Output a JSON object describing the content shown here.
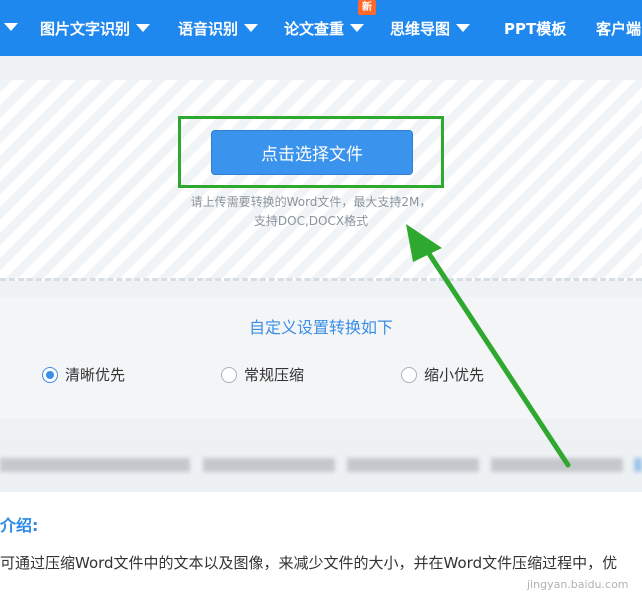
{
  "nav": {
    "items": [
      {
        "label": "图片文字识别",
        "dropdown": true
      },
      {
        "label": "语音识别",
        "dropdown": true
      },
      {
        "label": "论文查重",
        "dropdown": true,
        "badge": "新"
      },
      {
        "label": "思维导图",
        "dropdown": true
      },
      {
        "label": "PPT模板",
        "dropdown": false
      },
      {
        "label": "客户端",
        "dropdown": false
      }
    ]
  },
  "upload": {
    "button_label": "点击选择文件",
    "hint_line1": "请上传需要转换的Word文件，最大支持2M，",
    "hint_line2": "支持DOC,DOCX格式"
  },
  "settings": {
    "title": "自定义设置转换如下",
    "options": [
      {
        "label": "清晰优先",
        "selected": true
      },
      {
        "label": "常规压缩",
        "selected": false
      },
      {
        "label": "缩小优先",
        "selected": false
      }
    ]
  },
  "intro": {
    "title": "介绍:",
    "text": "可通过压缩Word文件中的文本以及图像，来减少文件的大小，并在Word文件压缩过程中，优"
  },
  "watermark": "jingyan.baidu.com",
  "colors": {
    "nav_bg": "#1e88ee",
    "button": "#3a93ec",
    "highlight": "#2ea82e",
    "accent": "#3a8ee6",
    "badge": "#ff6a2b"
  }
}
